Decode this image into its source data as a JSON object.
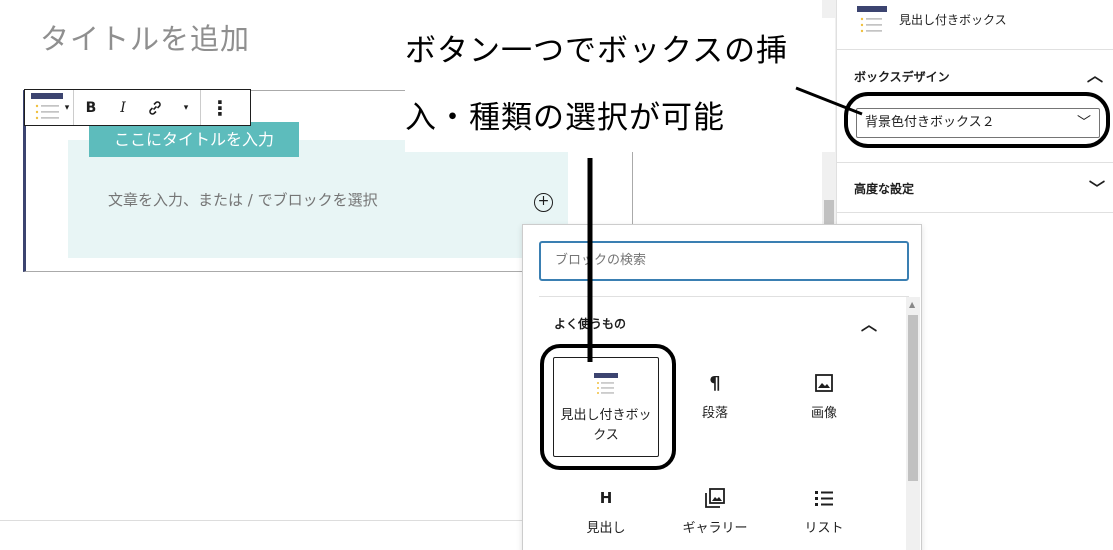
{
  "editor": {
    "post_title_placeholder": "タイトルを追加",
    "box_title": "ここにタイトルを入力",
    "box_placeholder": "文章を入力、または / でブロックを選択",
    "inserter_plus": "+"
  },
  "toolbar": {
    "bold_label": "B",
    "italic_label": "I",
    "link_icon": "link-icon",
    "caret": "▾",
    "more": "⋮"
  },
  "sidebar": {
    "block_card_name": "見出し付きボックス",
    "design_panel_title": "ボックスデザイン",
    "design_panel_chevron": "︿",
    "design_select_value": "背景色付きボックス２",
    "design_select_chevron": "﹀",
    "advanced_panel_title": "高度な設定",
    "advanced_panel_chevron": "﹀"
  },
  "inserter": {
    "search_placeholder": "ブロックの検索",
    "category_title": "よく使うもの",
    "category_chevron": "︿",
    "blocks": [
      {
        "label": "見出し付きボックス",
        "icon": "heading-box-icon"
      },
      {
        "label": "段落",
        "icon": "paragraph-icon",
        "glyph": "¶"
      },
      {
        "label": "画像",
        "icon": "image-icon"
      },
      {
        "label": "見出し",
        "icon": "heading-icon",
        "glyph": "H"
      },
      {
        "label": "ギャラリー",
        "icon": "gallery-icon"
      },
      {
        "label": "リスト",
        "icon": "list-icon"
      }
    ]
  },
  "annotation": {
    "line1": "ボタン一つでボックスの挿",
    "line2": "入・種類の選択が可能"
  },
  "colors": {
    "accent_blue": "#3a7fb2",
    "box_title_bg": "#5dbcbc",
    "box_body_bg": "#e8f5f5",
    "icon_navy": "#3c4470",
    "icon_yellow": "#f0c040"
  }
}
